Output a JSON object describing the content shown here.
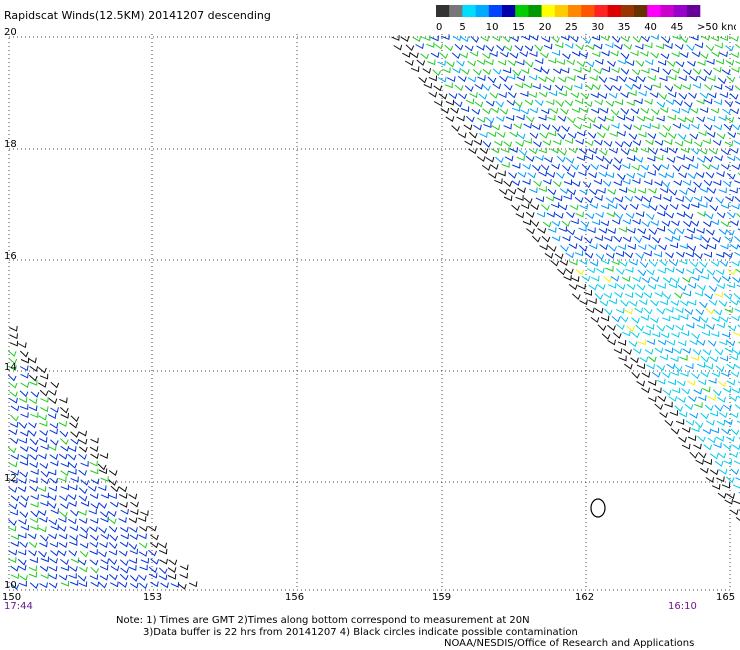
{
  "title": "Rapidscat Winds(12.5KM) 20141207 descending",
  "colorbar": {
    "labels": [
      "0",
      "5",
      "10",
      "15",
      "20",
      "25",
      "30",
      "35",
      "40",
      "45",
      ">50 knots"
    ],
    "colors": [
      "#333333",
      "#777777",
      "#00ddff",
      "#00aaff",
      "#0044ff",
      "#0000aa",
      "#00cc00",
      "#009900",
      "#ffff00",
      "#ffcc00",
      "#ff8800",
      "#ff5500",
      "#ff2222",
      "#dd0000",
      "#993300",
      "#663300",
      "#ff00ff",
      "#cc00cc",
      "#9900cc",
      "#660099"
    ]
  },
  "axes": {
    "lon_labels": [
      "150",
      "153",
      "156",
      "159",
      "162",
      "165"
    ],
    "lat_labels": [
      "20",
      "18",
      "16",
      "14",
      "12",
      "10"
    ]
  },
  "times": {
    "left": "17:44",
    "right": "16:10"
  },
  "notes": {
    "line1": "Note: 1) Times are GMT 2)Times along bottom correspond to measurement at 20N",
    "line2": "3)Data buffer is 22 hrs from 20141207 4) Black circles indicate possible contamination",
    "line3": "NOAA/NESDIS/Office of Research and Applications"
  }
}
